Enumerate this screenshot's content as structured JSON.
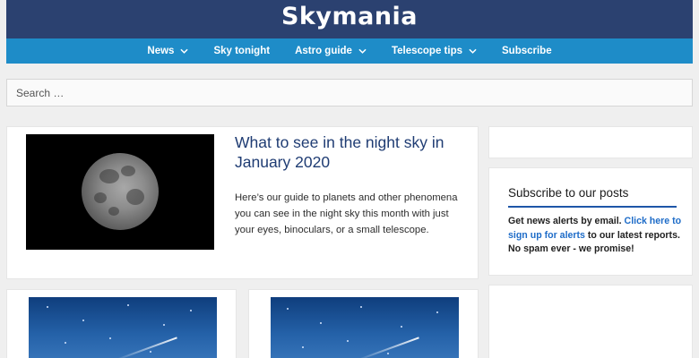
{
  "site": {
    "title": "Skymania"
  },
  "nav": {
    "items": [
      {
        "label": "News",
        "has_dropdown": true
      },
      {
        "label": "Sky tonight",
        "has_dropdown": false
      },
      {
        "label": "Astro guide",
        "has_dropdown": true
      },
      {
        "label": "Telescope tips",
        "has_dropdown": true
      },
      {
        "label": "Subscribe",
        "has_dropdown": false
      }
    ]
  },
  "search": {
    "placeholder": "Search …"
  },
  "featured_post": {
    "title": "What to see in the night sky in January 2020",
    "excerpt": "Here’s our guide to planets and other phenomena you can see in the night sky this month with just your eyes, binoculars, or a small telescope."
  },
  "sidebar": {
    "subscribe": {
      "title": "Subscribe to our posts",
      "text_before": "Get news alerts by email. ",
      "link_text": "Click here to sign up for alerts",
      "text_after": " to our latest reports. No spam ever - we promise!"
    }
  },
  "colors": {
    "header_bg": "#2b4170",
    "nav_bg": "#1e8cc8",
    "title_blue": "#1f3c73",
    "link_blue": "#1e6cc8"
  },
  "icons": {
    "dropdown": "chevron-down-icon"
  }
}
